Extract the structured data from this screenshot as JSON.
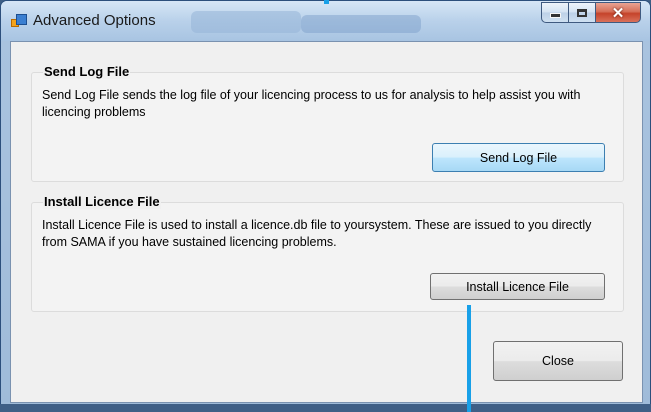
{
  "window": {
    "title": "Advanced Options"
  },
  "send_log": {
    "title": "Send Log File",
    "description": "Send Log File sends the log file of your licencing process to us for analysis to help assist you with licencing problems",
    "button_label": "Send Log File"
  },
  "install_licence": {
    "title": "Install Licence File",
    "description": "Install Licence File is used to install a licence.db file to yoursystem. These are issued to you directly from SAMA if you have sustained licencing problems.",
    "button_label": "Install Licence File"
  },
  "footer": {
    "close_label": "Close"
  },
  "icons": {
    "app": "app-window-icon",
    "minimize": "minimize-icon",
    "maximize": "maximize-icon",
    "close": "close-icon"
  },
  "colors": {
    "pointer": "#18a0e8",
    "close_button": "#c5432a"
  }
}
